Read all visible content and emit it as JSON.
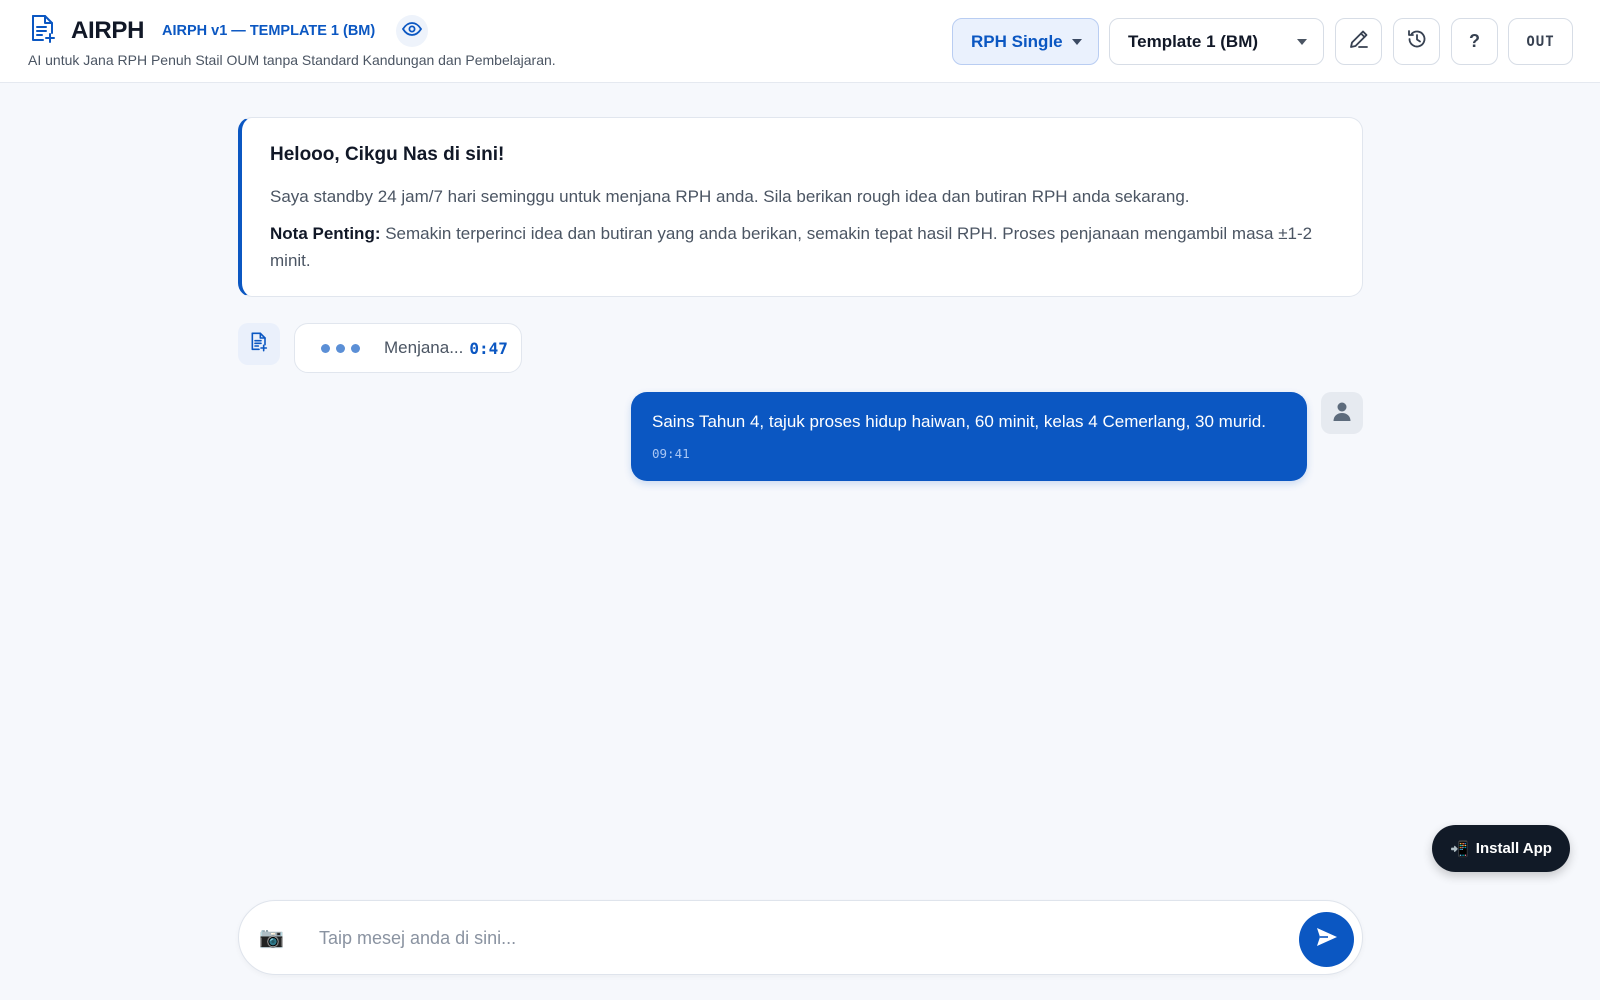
{
  "header": {
    "title": "AIRPH",
    "version": "AIRPH v1 — TEMPLATE 1 (BM)",
    "subtitle": "AI untuk Jana RPH Penuh Stail OUM tanpa Standard Kandungan dan Pembelajaran.",
    "mode_select": "RPH Single",
    "template_select": "Template 1 (BM)",
    "help_label": "?",
    "logout_label": "OUT",
    "icons": {
      "brand": "document-icon",
      "preview": "eye-icon",
      "edit": "pencil-icon",
      "history": "history-icon"
    }
  },
  "welcome": {
    "heading": "Helooo, Cikgu Nas di sini!",
    "body": "Saya standby 24 jam/7 hari seminggu untuk menjana RPH anda. Sila berikan rough idea dan butiran RPH anda sekarang.",
    "note_label": "Nota Penting:",
    "note_text": " Semakin terperinci idea dan butiran yang anda berikan, semakin tepat hasil RPH. Proses penjanaan mengambil masa ±1-2 minit."
  },
  "generating": {
    "label": "Menjana...",
    "timer": "0:47"
  },
  "user_message": {
    "text": "Sains Tahun 4, tajuk proses hidup haiwan, 60 minit, kelas 4 Cemerlang, 30 murid.",
    "time": "09:41"
  },
  "install": {
    "label": "Install App",
    "icon": "📲"
  },
  "composer": {
    "camera_icon": "📷",
    "placeholder": "Taip mesej anda di sini..."
  },
  "colors": {
    "accent": "#0b57c2",
    "background": "#f6f8fc",
    "install_bg": "#111a27"
  }
}
